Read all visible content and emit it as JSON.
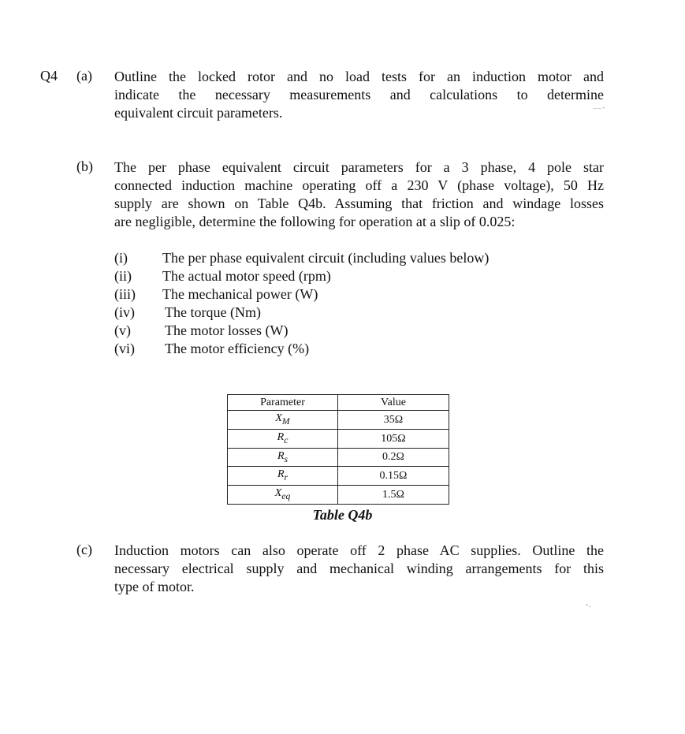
{
  "question_number": "Q4",
  "parts": {
    "a": {
      "label": "(a)",
      "lines": [
        "Outline the locked rotor and no load tests for an induction motor and",
        "indicate the necessary measurements and calculations to determine",
        "equivalent circuit parameters."
      ]
    },
    "b": {
      "label": "(b)",
      "lines": [
        "The per phase equivalent circuit parameters for a 3 phase, 4 pole star",
        "connected induction machine operating off a 230 V (phase voltage), 50 Hz",
        "supply are shown on Table Q4b. Assuming that friction and windage losses",
        "are negligible, determine the following for operation at a slip of 0.025:"
      ],
      "sub_items": [
        {
          "num": "(i)",
          "text": "The per phase equivalent circuit (including values below)"
        },
        {
          "num": "(ii)",
          "text": "The actual motor speed (rpm)"
        },
        {
          "num": "(iii)",
          "text": "The mechanical power (W)"
        },
        {
          "num": "(iv)",
          "text": "The torque (Nm)"
        },
        {
          "num": "(v)",
          "text": "The motor losses (W)"
        },
        {
          "num": "(vi)",
          "text": "The motor efficiency (%)"
        }
      ],
      "table": {
        "headers": [
          "Parameter",
          "Value"
        ],
        "rows": [
          {
            "param": "X",
            "sub": "M",
            "value": "35Ω"
          },
          {
            "param": "R",
            "sub": "c",
            "value": "105Ω"
          },
          {
            "param": "R",
            "sub": "s",
            "value": "0.2Ω"
          },
          {
            "param": "R",
            "sub": "r",
            "value": "0.15Ω"
          },
          {
            "param": "X",
            "sub": "eq",
            "value": "1.5Ω"
          }
        ],
        "caption": "Table Q4b"
      }
    },
    "c": {
      "label": "(c)",
      "lines": [
        "Induction motors can also operate off 2 phase AC supplies. Outline the",
        "necessary electrical supply and mechanical winding arrangements for this",
        "type of motor."
      ]
    }
  }
}
